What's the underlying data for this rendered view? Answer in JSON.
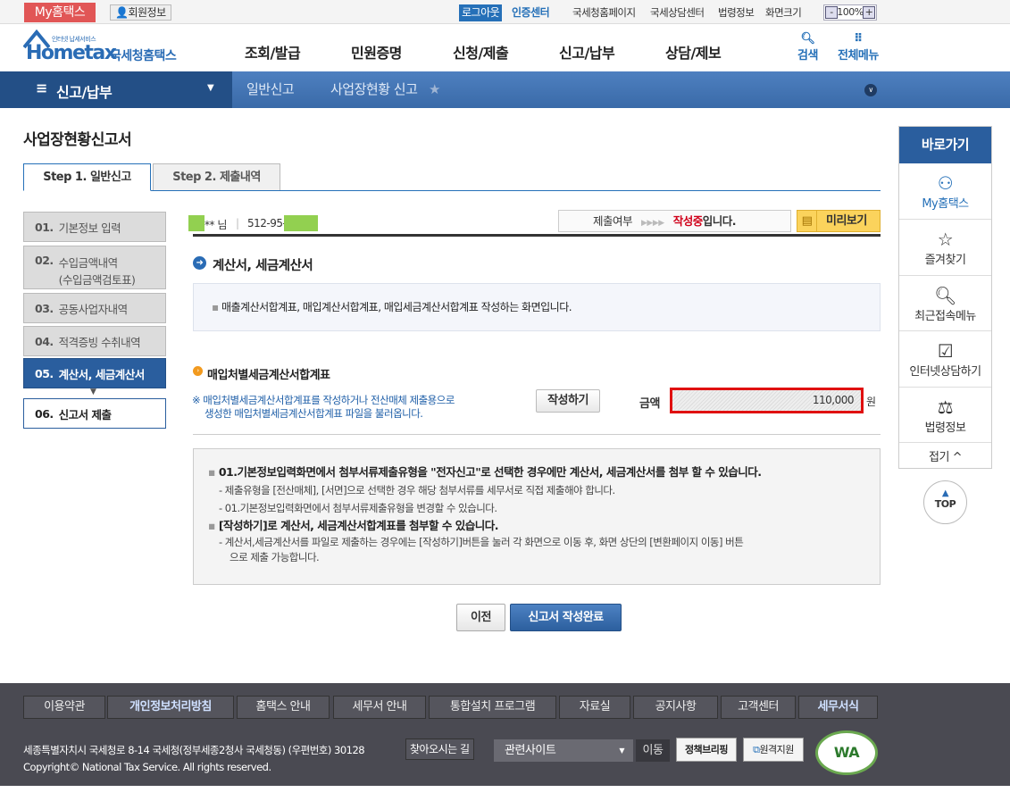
{
  "topbar": {
    "my_hometax": "My홈택스",
    "member_info": "회원정보",
    "logout": "로그아웃",
    "cert_center": "인증센터",
    "links": [
      "국세청홈페이지",
      "국세상담센터",
      "법령정보",
      "화면크기"
    ],
    "zoom": "100%",
    "zoom_minus": "-",
    "zoom_plus": "+"
  },
  "header": {
    "logo_text": "Hometax",
    "logo_sub": "국세청홈택스",
    "logo_tagline": "인터넷 납세서비스",
    "menu": [
      "조회/발급",
      "민원증명",
      "신청/제출",
      "신고/납부",
      "상담/제보"
    ],
    "search": "검색",
    "all_menu": "전체메뉴"
  },
  "nav": {
    "section": "신고/납부",
    "crumbs": [
      "일반신고",
      "사업장현황 신고"
    ]
  },
  "page": {
    "title": "사업장현황신고서",
    "tabs": [
      "Step 1. 일반신고",
      "Step 2. 제출내역"
    ]
  },
  "steps": [
    {
      "num": "01.",
      "label": "기본정보 입력"
    },
    {
      "num": "02.",
      "label": "수입금액내역",
      "label2": "(수입금액검토표)"
    },
    {
      "num": "03.",
      "label": "공동사업자내역"
    },
    {
      "num": "04.",
      "label": "적격증빙 수취내역"
    },
    {
      "num": "05.",
      "label": "계산서, 세금계산서"
    },
    {
      "num": "06.",
      "label": "신고서 제출"
    }
  ],
  "user": {
    "name_suffix": "** 님",
    "biz_no": "512-95-",
    "status_label": "제출여부",
    "status_value": "작성중",
    "status_suffix": "입니다.",
    "preview": "미리보기"
  },
  "section": {
    "title": "계산서, 세금계산서",
    "info": "매출계산서합계표, 매입계산서합계표, 매입세금계산서합계표 작성하는 화면입니다.",
    "sub_title": "매입처별세금계산서합계표",
    "note_line1": "※ 매입처별세금계산서합계표를 작성하거나 전산매체 제출용으로",
    "note_line2": "생성한 매입처별세금계산서합계표 파일을 불러옵니다.",
    "write_button": "작성하기",
    "amount_label": "금액",
    "amount_value": "110,000",
    "amount_unit": "원"
  },
  "notice": {
    "items": [
      "01.기본정보입력화면에서 첨부서류제출유형을 \"전자신고\"로 선택한 경우에만 계산서, 세금계산서를 첨부 할 수 있습니다.",
      "- 제출유형을 [전산매체], [서면]으로 선택한 경우 해당 첨부서류를 세무서로 직접 제출해야 합니다.",
      "- 01.기본정보입력화면에서 첨부서류제출유형을 변경할 수 있습니다.",
      "[작성하기]로 계산서, 세금계산서합계표를 첨부할 수 있습니다.",
      "- 계산서,세금계산서를 파일로 제출하는 경우에는 [작성하기]버튼을 눌러 각 화면으로 이동 후, 화면 상단의 [변환페이지 이동] 버튼",
      "으로 제출 가능합니다."
    ]
  },
  "buttons": {
    "prev": "이전",
    "complete": "신고서 작성완료"
  },
  "quick": {
    "title": "바로가기",
    "items": [
      "My홈택스",
      "즐겨찾기",
      "최근접속메뉴",
      "인터넷상담하기",
      "법령정보"
    ],
    "fold": "접기 ^",
    "top": "TOP"
  },
  "footer": {
    "links": [
      "이용약관",
      "개인정보처리방침",
      "홈택스 안내",
      "세무서 안내",
      "통합설치 프로그램",
      "자료실",
      "공지사항",
      "고객센터",
      "세무서식"
    ],
    "address": "세종특별자치시 국세청로 8-14 국세청(정부세종2청사 국세청동) (우편번호) 30128",
    "directions": "찾아오시는 길",
    "related": "관련사이트",
    "go": "이동",
    "policy": "정책브리핑",
    "remote": "원격지원",
    "copyright": "Copyright© National Tax Service. All rights reserved.",
    "wa_mark": "WA"
  },
  "colors": {
    "primary": "#2570b8",
    "status_red": "#d0021b",
    "highlight_border": "#e01010"
  }
}
